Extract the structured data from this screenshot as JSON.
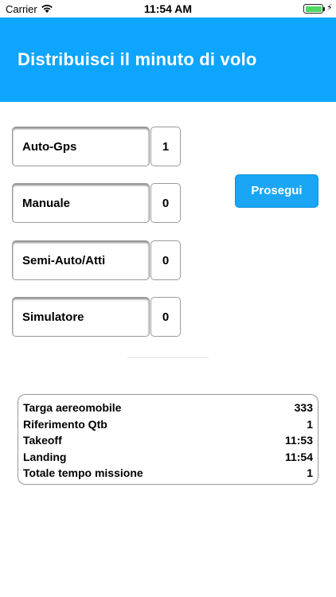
{
  "status_bar": {
    "carrier": "Carrier",
    "time": "11:54 AM",
    "battery_level": 1.0
  },
  "header": {
    "title": "Distribuisci il minuto di volo"
  },
  "modes": [
    {
      "label": "Auto-Gps",
      "value": "1"
    },
    {
      "label": "Manuale",
      "value": "0"
    },
    {
      "label": "Semi-Auto/Atti",
      "value": "0"
    },
    {
      "label": "Simulatore",
      "value": "0"
    }
  ],
  "proceed_button": {
    "label": "Prosegui"
  },
  "summary": [
    {
      "label": "Targa aereomobile",
      "value": "333"
    },
    {
      "label": "Riferimento Qtb",
      "value": "1"
    },
    {
      "label": "Takeoff",
      "value": "11:53"
    },
    {
      "label": "Landing",
      "value": "11:54"
    },
    {
      "label": "Totale tempo missione",
      "value": "1"
    }
  ],
  "colors": {
    "header": "#0ea5ff",
    "button": "#1aa6f5",
    "battery": "#4cd964"
  }
}
